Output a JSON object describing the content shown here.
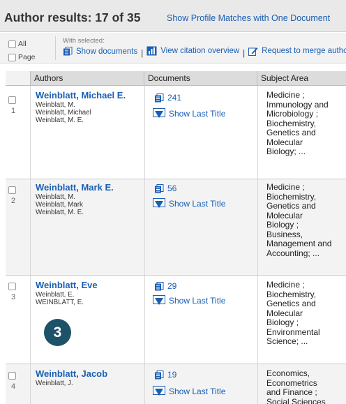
{
  "header": {
    "title": "Author results:  17 of 35",
    "profile_link": "Show Profile Matches with One Document"
  },
  "toolbar": {
    "all_label": "All",
    "page_label": "Page",
    "with_selected": "With selected:",
    "show_documents": "Show documents",
    "view_citation_overview": "View citation overview",
    "request_to_merge": "Request to merge authors"
  },
  "table": {
    "columns": [
      "Authors",
      "Documents",
      "Subject Area"
    ],
    "show_last_title": "Show Last Title",
    "rows": [
      {
        "index": "1",
        "name": "Weinblatt, Michael E.",
        "variants": [
          "Weinblatt, M.",
          "Weinblatt, Michael",
          "Weinblatt, M. E."
        ],
        "documents": "241",
        "subjects": [
          "Medicine ;",
          "Immunology and",
          "Microbiology ;",
          "Biochemistry,",
          "Genetics and",
          "Molecular",
          "Biology; ..."
        ]
      },
      {
        "index": "2",
        "name": "Weinblatt, Mark E.",
        "variants": [
          "Weinblatt, M.",
          "Weinblatt, Mark",
          "Weinblatt, M. E."
        ],
        "documents": "56",
        "subjects": [
          "Medicine ;",
          "Biochemistry,",
          "Genetics and",
          "Molecular",
          "Biology ;",
          "Business,",
          "Management and",
          "Accounting; ..."
        ]
      },
      {
        "index": "3",
        "name": "Weinblatt, Eve",
        "variants": [
          "Weinblatt, E.",
          "WEINBLATT, E."
        ],
        "documents": "29",
        "subjects": [
          "Medicine ;",
          "Biochemistry,",
          "Genetics and",
          "Molecular",
          "Biology ;",
          "Environmental",
          "Science; ..."
        ]
      },
      {
        "index": "4",
        "name": "Weinblatt, Jacob",
        "variants": [
          "Weinblatt, J."
        ],
        "documents": "19",
        "subjects": [
          "Economics,",
          "Econometrics",
          "and Finance ;",
          "Social Sciences"
        ]
      }
    ]
  },
  "annotation": {
    "step_number": "3"
  },
  "colors": {
    "link": "#1a5fb4",
    "header_bg": "#e9e9e9",
    "row_shade": "#f3f3f3",
    "badge": "#1e5269"
  },
  "icons": {
    "documents": "documents-icon",
    "citation": "bar-chart-icon",
    "request": "pencil-icon",
    "show_last_title": "down-arrow-box-icon"
  }
}
